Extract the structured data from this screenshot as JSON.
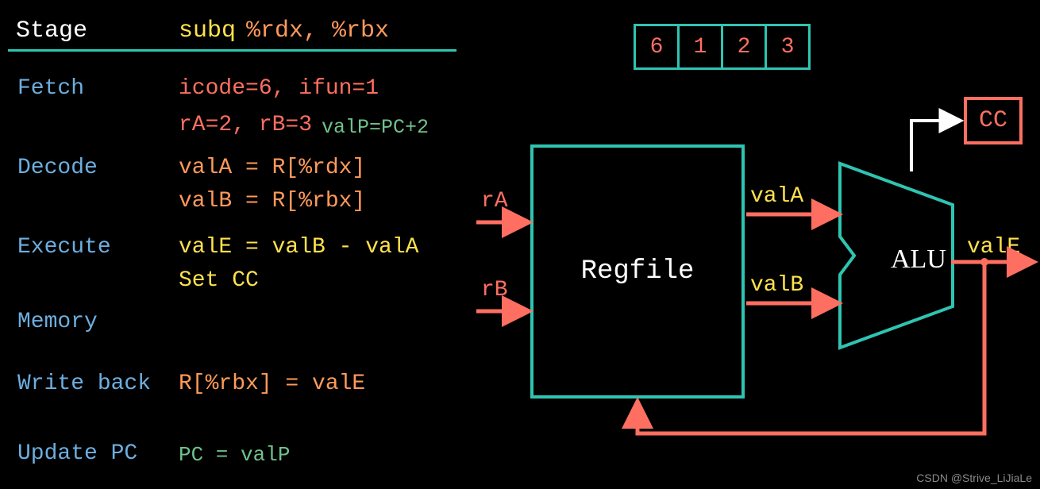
{
  "header": {
    "stage": "Stage",
    "mnemonic": "subq",
    "operands": "%rdx, %rbx"
  },
  "stages": {
    "fetch": "Fetch",
    "decode": "Decode",
    "execute": "Execute",
    "memory": "Memory",
    "writeback": "Write back",
    "updatepc": "Update PC"
  },
  "fetch": {
    "line1": "icode=6, ifun=1",
    "line2a": "rA=2, rB=3",
    "line2b": "valP=PC+2"
  },
  "decode": {
    "line1": "valA = R[%rdx]",
    "line2": "valB = R[%rbx]"
  },
  "execute": {
    "line1": "valE = valB - valA",
    "line2": "Set CC"
  },
  "writeback": {
    "line1": "R[%rbx] = valE"
  },
  "updatepc": {
    "line1": "PC = valP"
  },
  "bytes": [
    "6",
    "1",
    "2",
    "3"
  ],
  "datapath": {
    "rA": "rA",
    "rB": "rB",
    "regfile": "Regfile",
    "valA": "valA",
    "valB": "valB",
    "alu": "ALU",
    "valE": "valE",
    "cc": "CC"
  },
  "watermark": "CSDN @Strive_LiJiaLe"
}
